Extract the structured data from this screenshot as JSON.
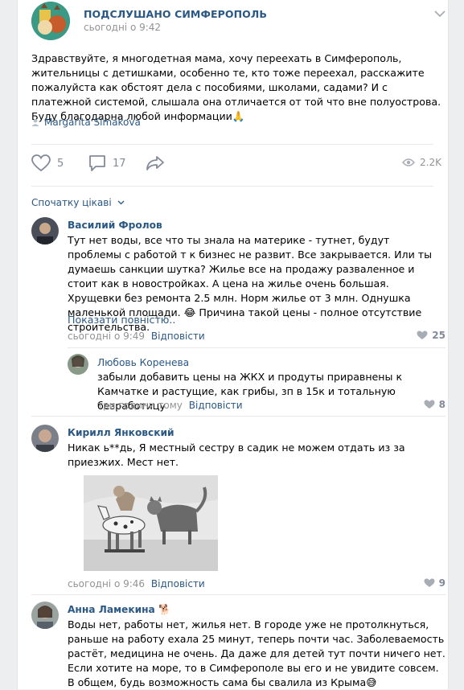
{
  "post": {
    "group_name": "ПОДСЛУШАНО СИМФЕРОПОЛЬ",
    "time": "сьогодні о 9:42",
    "text": "Здравствуйте, я многодетная мама, хочу переехать в Симферополь, жительницы с детишками, особенно те, кто тоже переехал, расскажите пожалуйста как обстоят дела с пособиями, школами, садами? И с платежной системой, слышала она отличается от той что вне полуострова. Буду благодарна любой информации🙏",
    "signer": "Margarita Simakova",
    "likes": "5",
    "comments": "17",
    "views": "2.2K"
  },
  "sort_label": "Спочатку цікаві",
  "comments": [
    {
      "name": "Василий Фролов",
      "text": "Тут нет воды, все что ты знала на материке - тутнет, будут проблемы с работой т к бизнес не развит. Все закрывается. Или ты думаешь санкции шутка? Жилье все на продажу разваленное и стоит как в новостройках. А цена на жилье очень большая. Хрущевки без ремонта 2.5 млн. Норм жилье от 3 млн. Однушка маленькой площади. 😂 Причина такой цены - полное отсутствие строительства.",
      "more": "Показати повністю..",
      "time": "сьогодні о 9:49",
      "reply": "Відповісти",
      "likes": "25"
    },
    {
      "name": "Любовь Коренева",
      "text": "забыли добавить цены на ЖКХ и продуты приравнены к Камчатке и растущие, как грибы, зп в 15к и тотальную безработицу",
      "time": "три години тому",
      "reply": "Відповісти",
      "likes": "8"
    },
    {
      "name": "Кирилл Янковский",
      "text": "Никак ь**дь, Я местный сестру в садик не можем отдать из за приезжих. Мест нет.",
      "time": "сьогодні о 9:46",
      "reply": "Відповісти",
      "likes": "9"
    },
    {
      "name": "Анна Ламекина 🐕",
      "text": "Воды нет, работы нет, жилья нет. В городе уже не протолкнуться, раньше на работу ехала 25 минут, теперь почти час. Заболеваемость растёт, медицина не очень. Да даже для детей тут почти ничего нет. Если хотите на море, то в Симферополе вы его и не увидите совсем. В общем, будь возможность сама бы свалила из Крыма😅"
    }
  ],
  "colors": {
    "link": "#2a5885",
    "muted": "#939393",
    "icon": "#828a99"
  }
}
